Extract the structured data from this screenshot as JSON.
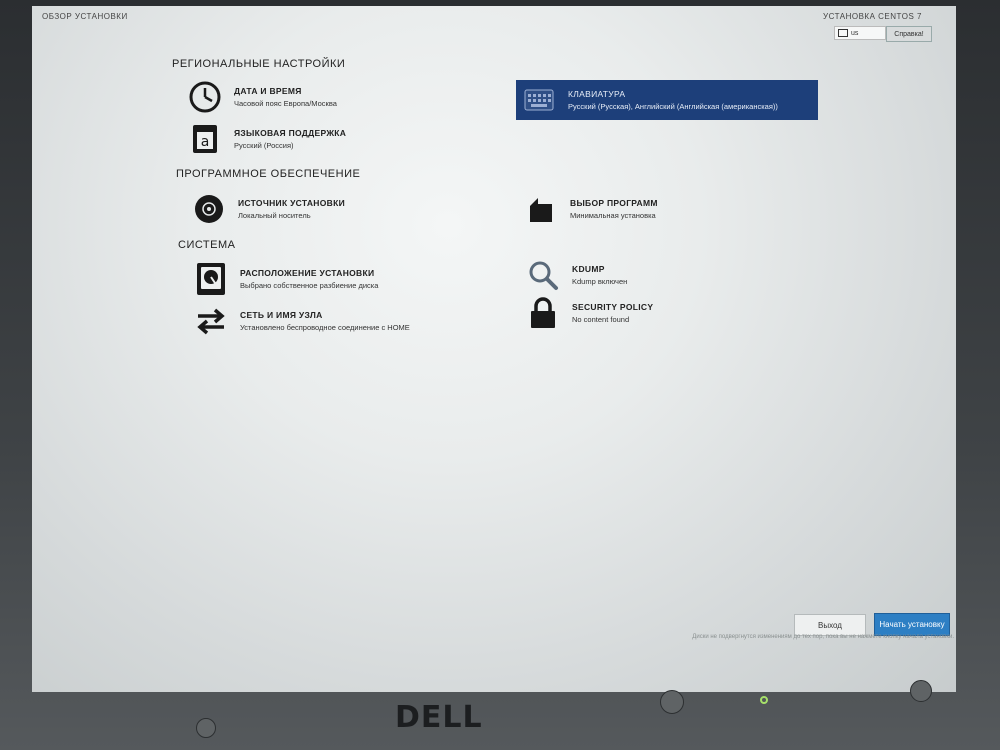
{
  "header": {
    "title": "ОБЗОР УСТАНОВКИ",
    "product": "УСТАНОВКА CENTOS 7",
    "keyboard_layout": "us",
    "help_label": "Справка!"
  },
  "sections": [
    {
      "title": "РЕГИОНАЛЬНЫЕ НАСТРОЙКИ",
      "spokes": [
        {
          "title": "ДАТА И ВРЕМЯ",
          "status": "Часовой пояс Европа/Москва",
          "icon": "clock-icon"
        },
        {
          "title": "КЛАВИАТУРА",
          "status": "Русский (Русская), Английский (Английская (американская))",
          "icon": "keyboard-icon",
          "selected": true
        },
        {
          "title": "ЯЗЫКОВАЯ ПОДДЕРЖКА",
          "status": "Русский (Россия)",
          "icon": "language-icon"
        }
      ]
    },
    {
      "title": "ПРОГРАММНОЕ ОБЕСПЕЧЕНИЕ",
      "spokes": [
        {
          "title": "ИСТОЧНИК УСТАНОВКИ",
          "status": "Локальный носитель",
          "icon": "disc-icon"
        },
        {
          "title": "ВЫБОР ПРОГРАММ",
          "status": "Минимальная установка",
          "icon": "package-icon"
        }
      ]
    },
    {
      "title": "СИСТЕМА",
      "spokes": [
        {
          "title": "РАСПОЛОЖЕНИЕ УСТАНОВКИ",
          "status": "Выбрано собственное разбиение диска",
          "icon": "harddisk-icon"
        },
        {
          "title": "KDUMP",
          "status": "Kdump включен",
          "icon": "magnifier-icon"
        },
        {
          "title": "СЕТЬ И ИМЯ УЗЛА",
          "status": "Установлено беспроводное соединение с HOME",
          "icon": "network-arrows-icon"
        },
        {
          "title": "SECURITY POLICY",
          "status": "No content found",
          "icon": "lock-icon"
        }
      ]
    }
  ],
  "footer": {
    "exit_label": "Выход",
    "start_label": "Начать установку",
    "note": "Диски не подвергнутся изменениям до тех пор, пока вы не нажмете кнопку начала установки."
  },
  "hardware": {
    "brand": "DELL"
  }
}
